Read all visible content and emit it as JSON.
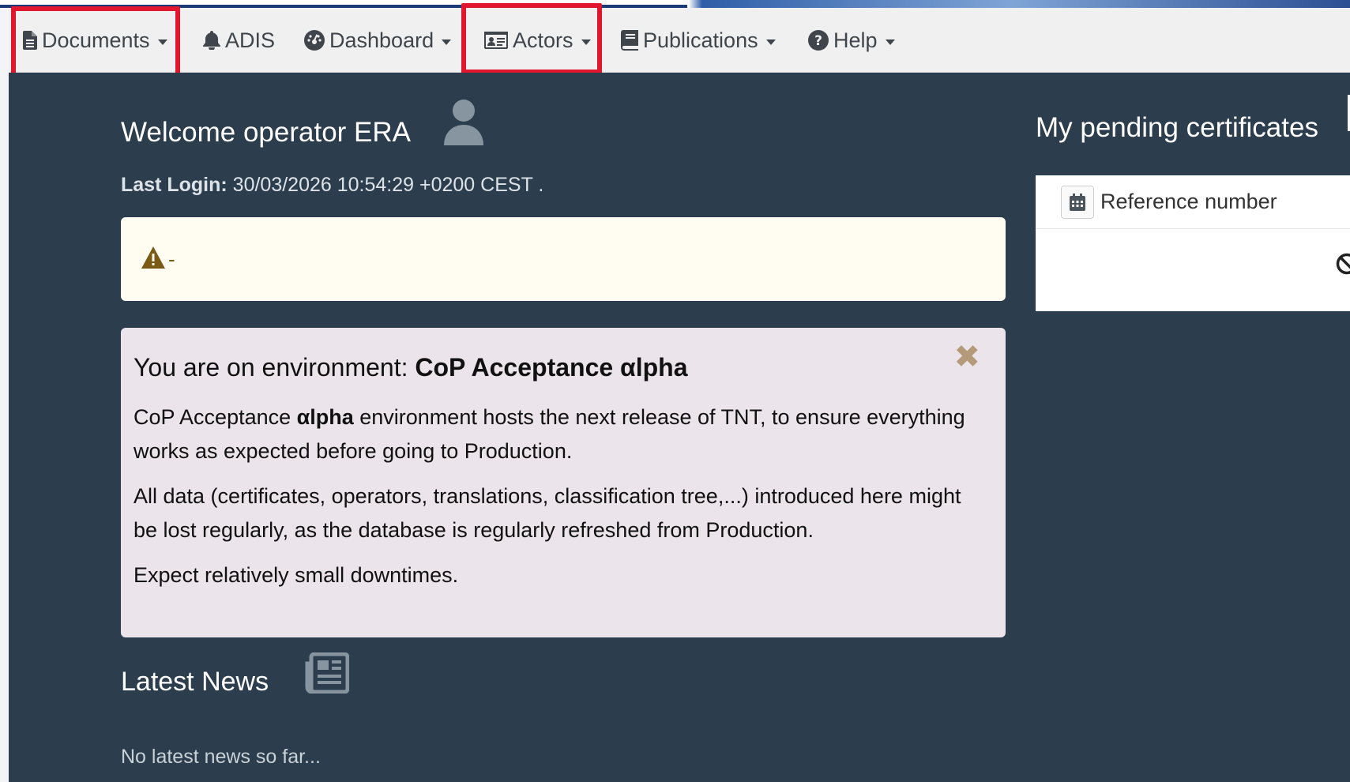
{
  "nav": {
    "items": [
      {
        "label": "Documents",
        "icon": "file-icon",
        "dropdown": true
      },
      {
        "label": "ADIS",
        "icon": "bell-icon",
        "dropdown": false
      },
      {
        "label": "Dashboard",
        "icon": "dashboard-icon",
        "dropdown": true
      },
      {
        "label": "Actors",
        "icon": "id-card-icon",
        "dropdown": true
      },
      {
        "label": "Publications",
        "icon": "book-icon",
        "dropdown": true
      },
      {
        "label": "Help",
        "icon": "question-circle-icon",
        "dropdown": true
      }
    ],
    "highlighted": [
      "Documents",
      "Actors"
    ]
  },
  "welcome": {
    "text": "Welcome operator ERA"
  },
  "last_login": {
    "label": "Last Login:",
    "value": "30/03/2026 10:54:29 +0200 CEST ."
  },
  "warning": {
    "text": "-"
  },
  "environment": {
    "title_prefix": "You are on environment: ",
    "title_name": "CoP Acceptance αlpha",
    "p1_part1": "CoP Acceptance ",
    "p1_bold": "αlpha",
    "p1_part2": " environment hosts the next release of TNT, to ensure everything works as expected before going to Production.",
    "p2": "All data (certificates, operators, translations, classification tree,...) introduced here might be lost regularly, as the database is regularly refreshed from Production.",
    "p3": "Expect relatively small downtimes.",
    "close": "✖"
  },
  "news": {
    "title": "Latest News",
    "empty": "No latest news so far..."
  },
  "pending": {
    "title": "My pending certificates",
    "column": "Reference number"
  },
  "colors": {
    "navbar_bg": "#f0f0f0",
    "main_bg": "#2c3e4d",
    "highlight": "#e0172e",
    "warning_bg": "#fffcf2",
    "env_bg": "#ebe4ea"
  }
}
